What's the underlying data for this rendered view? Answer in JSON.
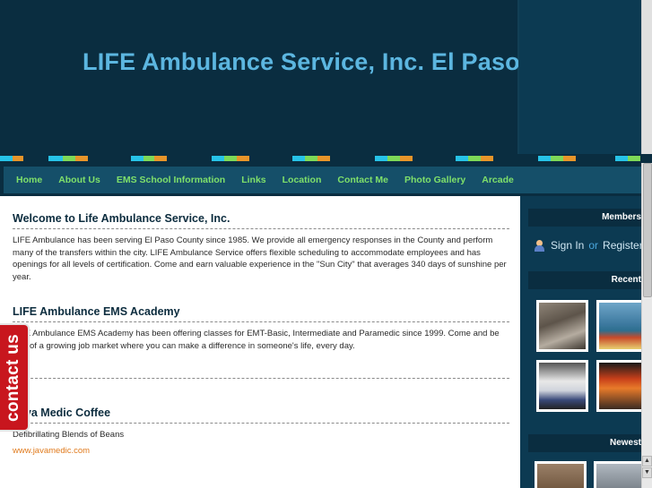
{
  "header": {
    "title": "LIFE Ambulance Service, Inc. El Paso"
  },
  "colors": {
    "stripe": [
      "#27c3e8",
      "#7ed957",
      "#e8952a",
      "#0e5c7a"
    ]
  },
  "nav": {
    "items": [
      {
        "label": "Home"
      },
      {
        "label": "About Us"
      },
      {
        "label": "EMS School Information"
      },
      {
        "label": "Links"
      },
      {
        "label": "Location"
      },
      {
        "label": "Contact Me"
      },
      {
        "label": "Photo Gallery"
      },
      {
        "label": "Arcade"
      }
    ]
  },
  "main": {
    "welcome": {
      "heading": "Welcome to Life Ambulance Service, Inc.",
      "body": "LIFE Ambulance has been serving El Paso County since 1985. We provide all emergency responses in the County and perform many of the transfers within the city. LIFE Ambulance Service offers flexible scheduling to accommodate employees and has openings for all levels of certification. Come and earn valuable experience in the \"Sun City\" that averages 340 days of sunshine per year."
    },
    "academy": {
      "heading": "LIFE Ambulance EMS Academy",
      "body": "LIFE Ambulance EMS Academy has been offering classes for EMT-Basic, Intermediate and Paramedic since 1999. Come and be part of a growing job market where you can make a difference in someone's life, every day."
    },
    "coffee": {
      "heading": "Java Medic Coffee",
      "body": "Defibrillating Blends of Beans",
      "link": "www.javamedic.com"
    }
  },
  "contact_tab": {
    "label": "contact us"
  },
  "sidebar": {
    "members_heading": "Members",
    "signin": {
      "sign_in": "Sign In",
      "or": "or",
      "register": "Register"
    },
    "recent_heading": "Recent",
    "newest_heading": "Newest"
  }
}
